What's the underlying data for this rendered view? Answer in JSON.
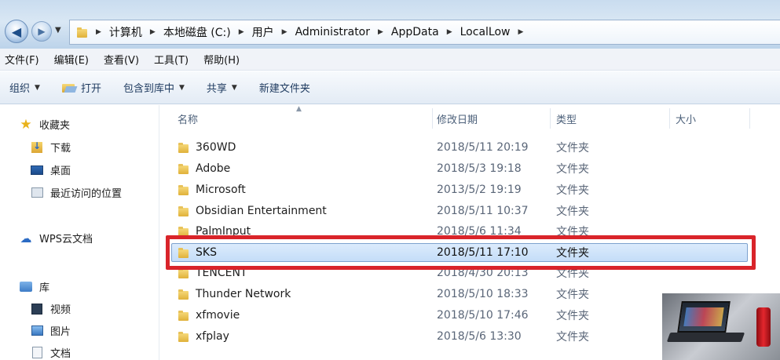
{
  "address_bar": {
    "crumbs": [
      "计算机",
      "本地磁盘 (C:)",
      "用户",
      "Administrator",
      "AppData",
      "LocalLow"
    ]
  },
  "menu": {
    "items": [
      "文件(F)",
      "编辑(E)",
      "查看(V)",
      "工具(T)",
      "帮助(H)"
    ]
  },
  "toolbar": {
    "organize_label": "组织",
    "open_label": "打开",
    "include_label": "包含到库中",
    "share_label": "共享",
    "new_folder_label": "新建文件夹"
  },
  "nav_pane": {
    "favorites_label": "收藏夹",
    "downloads_label": "下载",
    "desktop_label": "桌面",
    "recent_label": "最近访问的位置",
    "wps_label": "WPS云文档",
    "libraries_label": "库",
    "videos_label": "视频",
    "pictures_label": "图片",
    "documents_label": "文档"
  },
  "file_list": {
    "columns": {
      "name": "名称",
      "modified": "修改日期",
      "type": "类型",
      "size": "大小"
    },
    "rows": [
      {
        "name": "360WD",
        "modified": "2018/5/11 20:19",
        "type": "文件夹"
      },
      {
        "name": "Adobe",
        "modified": "2018/5/3 19:18",
        "type": "文件夹"
      },
      {
        "name": "Microsoft",
        "modified": "2013/5/2 19:19",
        "type": "文件夹"
      },
      {
        "name": "Obsidian Entertainment",
        "modified": "2018/5/11 10:37",
        "type": "文件夹"
      },
      {
        "name": "PalmInput",
        "modified": "2018/5/6 11:34",
        "type": "文件夹"
      },
      {
        "name": "SKS",
        "modified": "2018/5/11 17:10",
        "type": "文件夹"
      },
      {
        "name": "TENCENT",
        "modified": "2018/4/30 20:13",
        "type": "文件夹"
      },
      {
        "name": "Thunder Network",
        "modified": "2018/5/10 18:33",
        "type": "文件夹"
      },
      {
        "name": "xfmovie",
        "modified": "2018/5/10 17:46",
        "type": "文件夹"
      },
      {
        "name": "xfplay",
        "modified": "2018/5/6 13:30",
        "type": "文件夹"
      }
    ],
    "selected_name": "SKS"
  },
  "colors": {
    "highlight_frame": "#d9242a",
    "selection_fill": "#cde3fa",
    "folder_yellow": "#e8c25a"
  },
  "icons": {
    "back": "arrow-left-icon",
    "forward": "arrow-right-icon",
    "folder": "folder-icon",
    "favorites": "star-icon",
    "wps": "cloud-icon"
  }
}
